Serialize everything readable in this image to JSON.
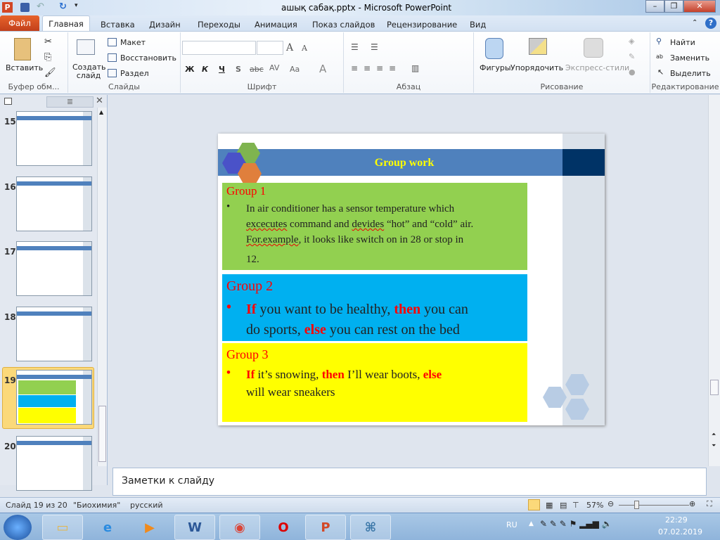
{
  "window": {
    "title": "ашық сабақ.pptx - Microsoft PowerPoint",
    "minimize": "–",
    "restore": "❐",
    "close": "✕"
  },
  "tabs": {
    "file": "Файл",
    "items": [
      "Главная",
      "Вставка",
      "Дизайн",
      "Переходы",
      "Анимация",
      "Показ слайдов",
      "Рецензирование",
      "Вид"
    ]
  },
  "ribbon": {
    "clipboard": {
      "paste": "Вставить",
      "label": "Буфер обм..."
    },
    "slides": {
      "new_slide": "Создать слайд",
      "layout": "Макет",
      "reset": "Восстановить",
      "section": "Раздел",
      "label": "Слайды"
    },
    "font": {
      "bold": "Ж",
      "italic": "К",
      "underline": "Ч",
      "shadow": "S",
      "strike": "abc",
      "spacing": "AV",
      "case": "Aa",
      "color": "A",
      "grow": "A",
      "shrink": "A",
      "label": "Шрифт"
    },
    "paragraph": {
      "label": "Абзац"
    },
    "drawing": {
      "shapes": "Фигуры",
      "arrange": "Упорядочить",
      "quick_styles": "Экспресс-стили",
      "label": "Рисование"
    },
    "editing": {
      "find": "Найти",
      "replace": "Заменить",
      "select": "Выделить",
      "label": "Редактирование"
    }
  },
  "thumbnails": [
    {
      "num": "15"
    },
    {
      "num": "16"
    },
    {
      "num": "17"
    },
    {
      "num": "18"
    },
    {
      "num": "19",
      "selected": true
    },
    {
      "num": "20"
    }
  ],
  "slide": {
    "title": "Group work",
    "group1": {
      "heading": "Group 1",
      "bullet": "•",
      "l1": "In air conditioner  has a sensor temperature which",
      "l2a": "excecutes",
      "l2b": " command and ",
      "l2c": "devides",
      "l2d": " “hot” and “cold” air.",
      "l3a": "For.example",
      "l3b": ", it looks like switch on in 28 or stop in",
      "l4": "12."
    },
    "group2": {
      "heading": "Group 2",
      "bullet": "•",
      "if": "If",
      "t1": " you want to be healthy, ",
      "then": "then",
      "t2": "  you can",
      "t3": "do sports, ",
      "else": "else",
      "t4": "  you can rest on the bed"
    },
    "group3": {
      "heading": "Group 3",
      "bullet": "•",
      "if": "If",
      "t1": " it’s snowing, ",
      "then": "then",
      "t2": "  I’ll wear boots, ",
      "else": "else",
      "t3": "will wear sneakers"
    }
  },
  "notes": {
    "placeholder": "Заметки к слайду"
  },
  "status": {
    "slide": "Слайд 19 из 20",
    "theme": "\"Биохимия\"",
    "language": "русский",
    "zoom": "57%"
  },
  "taskbar": {
    "lang": "RU",
    "time": "22:29",
    "date": "07.02.2019"
  },
  "colors": {
    "group1": "#92d050",
    "group2": "#00b0f0",
    "group3": "#ffff00",
    "band": "#4f81bd",
    "title": "#ffff00"
  }
}
